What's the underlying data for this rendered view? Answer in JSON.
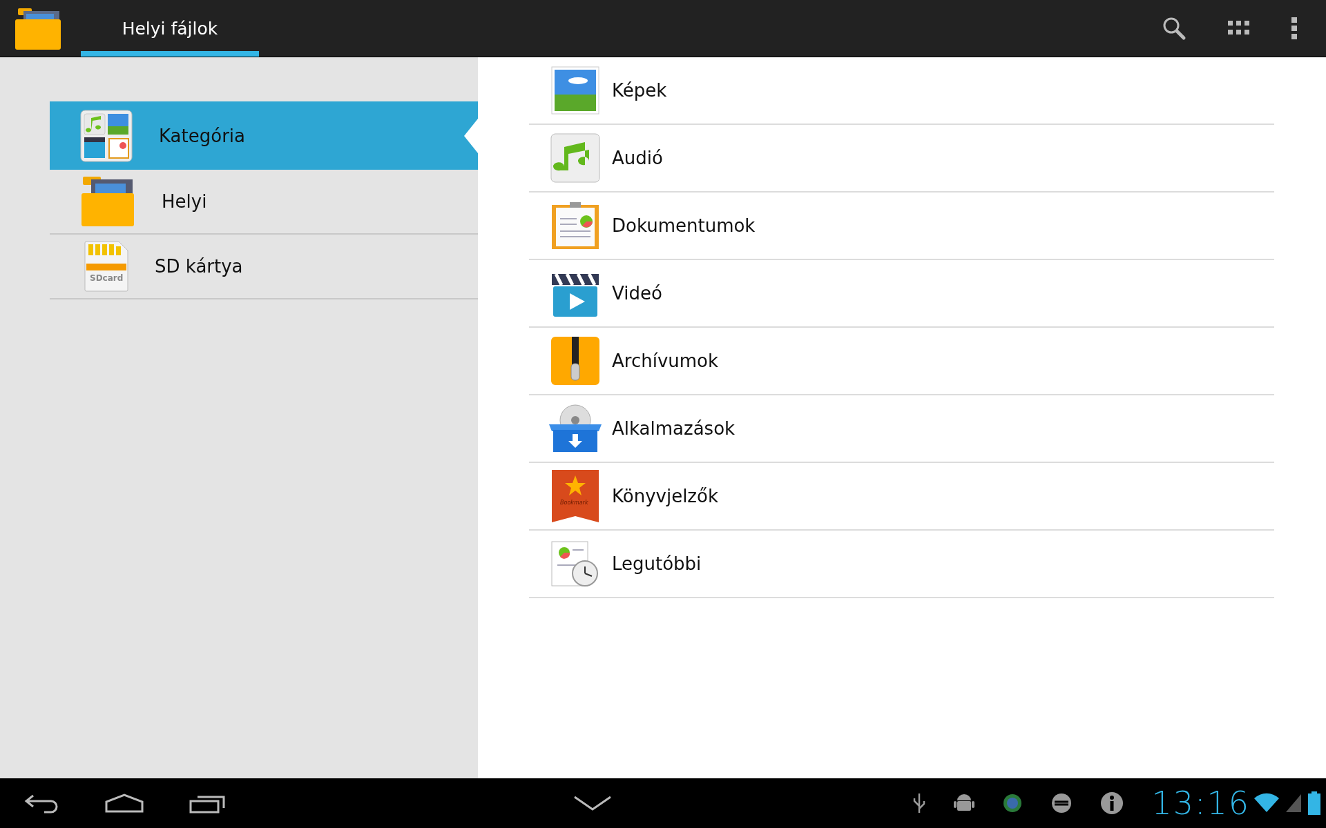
{
  "action_bar": {
    "tab": {
      "label": "Helyi fájlok",
      "selected": true
    }
  },
  "sidebar": {
    "items": [
      {
        "kind": "category",
        "label": "Kategória",
        "selected": true
      },
      {
        "kind": "local",
        "label": "Helyi",
        "selected": false
      },
      {
        "kind": "sdcard",
        "label": "SD kártya",
        "selected": false,
        "icon_text": "SDcard"
      }
    ]
  },
  "categories": [
    {
      "kind": "pictures",
      "label": "Képek"
    },
    {
      "kind": "audio",
      "label": "Audió"
    },
    {
      "kind": "documents",
      "label": "Dokumentumok"
    },
    {
      "kind": "video",
      "label": "Videó"
    },
    {
      "kind": "archives",
      "label": "Archívumok"
    },
    {
      "kind": "apps",
      "label": "Alkalmazások"
    },
    {
      "kind": "bookmarks",
      "label": "Könyvjelzők",
      "icon_text": "Bookmark"
    },
    {
      "kind": "recent",
      "label": "Legutóbbi"
    }
  ],
  "status_bar": {
    "time": "13:16"
  }
}
